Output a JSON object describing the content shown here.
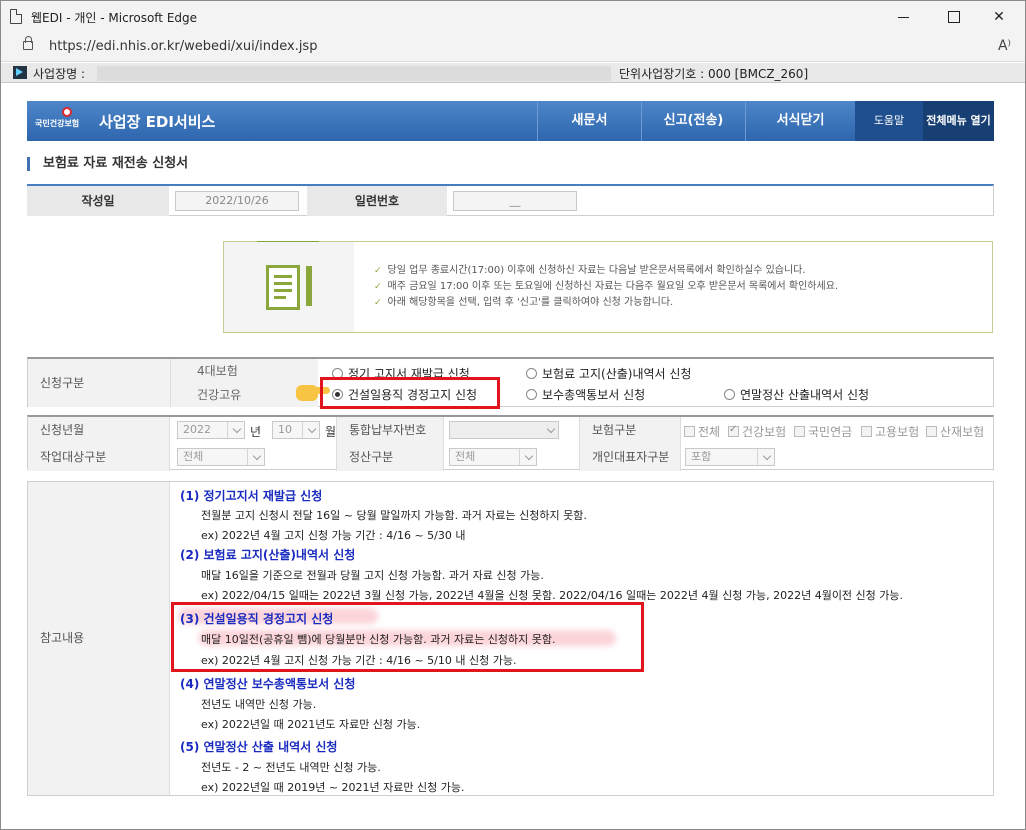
{
  "window": {
    "title": "웹EDI - 개인 - Microsoft Edge",
    "url": "https://edi.nhis.or.kr/webedi/xui/index.jsp"
  },
  "infobar": {
    "biz_label": "사업장명 :",
    "unit_label": "단위사업장기호 : 000 [BMCZ_260]"
  },
  "nav": {
    "logo_text": "국민건강보험",
    "brand": "사업장 EDI서비스",
    "menu": [
      "새문서",
      "신고(전송)",
      "서식닫기"
    ],
    "help": "도움말",
    "all_menu": "전체메뉴 열기"
  },
  "page_title": "보험료 자료 재전송 신청서",
  "form_head": {
    "date_label": "작성일",
    "date_value": "2022/10/26",
    "serial_label": "일련번호",
    "serial_value": "__"
  },
  "notice": [
    "당일 업무 종료시간(17:00) 이후에 신청하신 자료는 다음날 받은문서목록에서 확인하실수 있습니다.",
    "매주 금요일 17:00 이후 또는 토요일에 신청하신 자료는 다음주 월요일 오후 받은문서 목록에서 확인하세요.",
    "아래 해당항목을 선택, 입력 후 '신고'를 클릭하여야 신청 가능합니다."
  ],
  "request_type": {
    "label": "신청구분",
    "sub1": "4대보험",
    "sub2": "건강고유",
    "options": [
      "정기 고지서 재발급 신청",
      "보험료 고지(산출)내역서 신청",
      "건설일용직 경정고지 신청",
      "보수총액통보서 신청",
      "연말정산 산출내역서 신청"
    ],
    "selected": "건설일용직 경정고지 신청"
  },
  "filters": {
    "year_month_label": "신청년월",
    "year": "2022",
    "year_suffix": "년",
    "month": "10",
    "month_suffix": "월",
    "payer_label": "통합납부자번호",
    "insurance_label": "보험구분",
    "insurance_options": [
      "전체",
      "건강보험",
      "국민연금",
      "고용보험",
      "산재보험"
    ],
    "work_target_label": "작업대상구분",
    "work_target_value": "전체",
    "settle_label": "정산구분",
    "settle_value": "전체",
    "rep_label": "개인대표자구분",
    "rep_value": "포함"
  },
  "reference": {
    "label": "참고내용",
    "items": [
      {
        "title": "(1) 정기고지서 재발급 신청",
        "lines": [
          "전월분 고지 신청시 전달 16일 ~ 당월 말일까지 가능함. 과거 자료는 신청하지 못함.",
          "ex) 2022년 4월 고지 신청 가능 기간 : 4/16 ~ 5/30 내"
        ]
      },
      {
        "title": "(2) 보험료 고지(산출)내역서 신청",
        "lines": [
          "매달 16일을 기준으로 전월과 당월 고지 신청 가능함. 과거 자료 신청 가능.",
          "ex) 2022/04/15 일때는 2022년 3월 신청 가능, 2022년 4월을 신청 못함. 2022/04/16 일때는 2022년 4월 신청 가능, 2022년 4월이전 신청 가능."
        ]
      },
      {
        "title": "(3) 건설일용직 경정고지 신청",
        "lines": [
          "매달 10일전(공휴일 뺌)에 당월분만 신청 가능함. 과거 자료는 신청하지 못함.",
          "ex) 2022년 4월 고지 신청 가능 기간 : 4/16 ~ 5/10 내 신청 가능."
        ]
      },
      {
        "title": "(4) 연말정산 보수총액통보서 신청",
        "lines": [
          "전년도 내역만 신청 가능.",
          "ex) 2022년일 때 2021년도 자료만 신청 가능."
        ]
      },
      {
        "title": "(5) 연말정산 산출 내역서 신청",
        "lines": [
          "전년도 - 2 ~ 전년도 내역만 신청 가능.",
          "ex) 2022년일 때 2019년 ~ 2021년 자료만 신청 가능."
        ]
      }
    ]
  },
  "colors": {
    "nav_blue": "#2d66ad",
    "highlight_red": "#e0161c",
    "title_blue": "#1a2bbf",
    "notice_green": "#8aa73b"
  }
}
